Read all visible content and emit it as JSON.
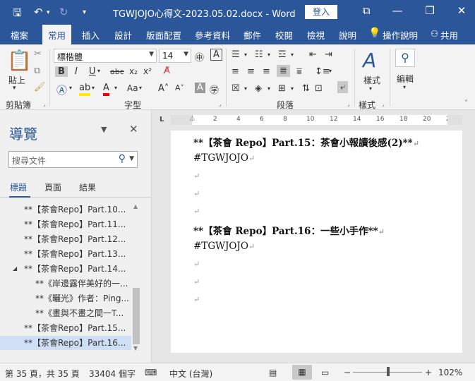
{
  "titlebar": {
    "title": "TGWJOJO心得文-2023.05.02.docx - Word",
    "signin": "登入",
    "min": "—",
    "restore": "❐",
    "close": "✕"
  },
  "tabs": [
    "檔案",
    "常用",
    "插入",
    "設計",
    "版面配置",
    "參考資料",
    "郵件",
    "校閱",
    "檢視",
    "說明",
    "操作說明",
    "共用"
  ],
  "ribbon": {
    "paste": "貼上",
    "font_name": "標楷體",
    "font_size": "14",
    "groups": {
      "clipboard": "剪貼簿",
      "font": "字型",
      "paragraph": "段落",
      "styles": "樣式",
      "editing": "編輯"
    },
    "styles_label": "樣式",
    "editing_label": "編輯"
  },
  "nav": {
    "title": "導覽",
    "search_placeholder": "搜尋文件",
    "tabs": [
      "標題",
      "頁面",
      "結果"
    ],
    "items": [
      {
        "text": "**【茶會Repo】Part.10...",
        "level": 1,
        "expanded": false,
        "selected": false
      },
      {
        "text": "**【茶會Repo】Part.11...",
        "level": 1,
        "expanded": false,
        "selected": false
      },
      {
        "text": "**【茶會Repo】Part.12...",
        "level": 1,
        "expanded": false,
        "selected": false
      },
      {
        "text": "**【茶會Repo】Part.13...",
        "level": 1,
        "expanded": false,
        "selected": false
      },
      {
        "text": "**【茶會Repo】Part.14...",
        "level": 1,
        "expanded": true,
        "selected": false
      },
      {
        "text": "**《岸邊露伴美好的一...",
        "level": 2,
        "expanded": false,
        "selected": false
      },
      {
        "text": "**《曬光》作者：Ping...",
        "level": 2,
        "expanded": false,
        "selected": false
      },
      {
        "text": "**《畫與不畫之間一T...",
        "level": 2,
        "expanded": false,
        "selected": false
      },
      {
        "text": "**【茶會Repo】Part.15...",
        "level": 1,
        "expanded": false,
        "selected": false
      },
      {
        "text": "**【茶會Repo】Part.16...",
        "level": 1,
        "expanded": false,
        "selected": true
      }
    ]
  },
  "ruler": {
    "marks": [
      "2",
      "4",
      "6",
      "8",
      "10",
      "12",
      "14",
      "16",
      "18",
      "20",
      "22"
    ],
    "corner": "L"
  },
  "document": {
    "lines": [
      {
        "text": "**【茶會 Repo】Part.15：茶會小報讀後感(2)**",
        "bold": true
      },
      {
        "text": "#TGWJOJO",
        "bold": false
      },
      {
        "text": "",
        "bold": false
      },
      {
        "text": "",
        "bold": false
      },
      {
        "text": "",
        "bold": false
      },
      {
        "text": "**【茶會 Repo】Part.16：一些小手作**",
        "bold": true
      },
      {
        "text": "#TGWJOJO",
        "bold": false
      },
      {
        "text": "",
        "bold": false
      },
      {
        "text": "",
        "bold": false
      },
      {
        "text": "",
        "bold": false
      }
    ],
    "para_mark": "↵"
  },
  "status": {
    "page": "第 35 頁，共 35 頁",
    "words": "33404 個字",
    "language": "中文 (台灣)",
    "zoom": "102%",
    "zoom_level": 0.51
  },
  "colors": {
    "accent": "#2b579a",
    "selected": "#cfe0f6"
  }
}
